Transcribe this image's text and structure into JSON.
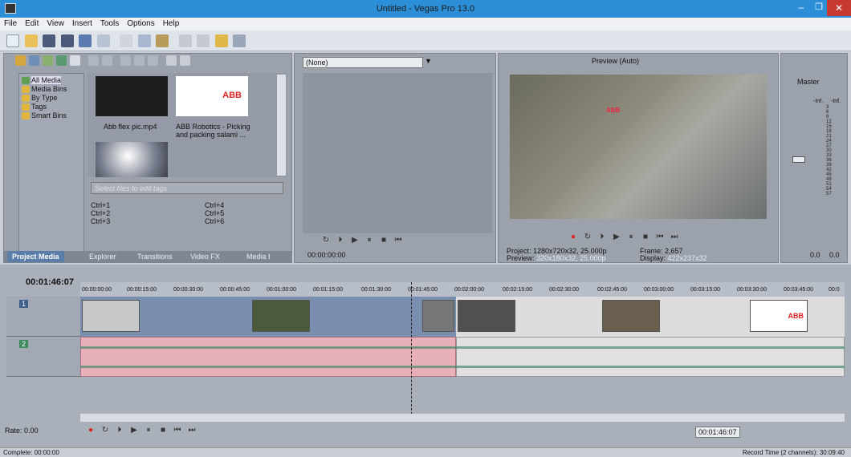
{
  "window": {
    "title": "Untitled - Vegas Pro 13.0"
  },
  "menu": [
    "File",
    "Edit",
    "View",
    "Insert",
    "Tools",
    "Options",
    "Help"
  ],
  "explorer": {
    "tree": [
      "All Media",
      "Media Bins",
      "By Type",
      "Tags",
      "Smart Bins"
    ],
    "media": [
      {
        "name": "Abb flex pic.mp4"
      },
      {
        "name": "ABB Robotics - Picking and packing salami ..."
      }
    ],
    "tags_placeholder": "Select files to edit tags",
    "shortcuts": [
      "Ctrl+1",
      "Ctrl+2",
      "Ctrl+3",
      "Ctrl+4",
      "Ctrl+5",
      "Ctrl+6"
    ],
    "tabs": [
      "Project Media",
      "Explorer",
      "Transitions",
      "Video FX",
      "Media I"
    ]
  },
  "trimmer": {
    "source": "(None)",
    "timecode": "00:00:00:00"
  },
  "preview": {
    "mode": "Preview (Auto)",
    "project_label": "Project:",
    "project": "1280x720x32, 25.000p",
    "preview_label": "Preview:",
    "preview": "320x180x32, 25.000p",
    "frame_label": "Frame:",
    "frame": "2,657",
    "display_label": "Display:",
    "display": "422x237x32"
  },
  "mixer": {
    "title": "Master",
    "left": "-Inf.",
    "right": "-Inf.",
    "scale": [
      "3",
      "6",
      "9",
      "12",
      "15",
      "18",
      "21",
      "24",
      "27",
      "30",
      "33",
      "36",
      "39",
      "42",
      "45",
      "48",
      "51",
      "54",
      "57"
    ],
    "value_l": "0.0",
    "value_r": "0.0"
  },
  "timeline": {
    "time": "00:01:46:07",
    "ruler": [
      "00:00:00:00",
      "00:00:15:00",
      "00:00:30:00",
      "00:00:45:00",
      "00:01:00:00",
      "00:01:15:00",
      "00:01:30:00",
      "00:01:45:00",
      "00:02:00:00",
      "00:02:15:00",
      "00:02:30:00",
      "00:02:45:00",
      "00:03:00:00",
      "00:03:15:00",
      "00:03:30:00",
      "00:03:45:00",
      "00:0"
    ],
    "track1": "1",
    "track2": "2",
    "rate": "Rate: 0.00",
    "timecode": "00:01:46:07"
  },
  "statusbar": {
    "left": "Complete: 00:00:00",
    "right": "Record Time (2 channels): 30:09:40"
  },
  "colors": {
    "titlebar": "#2b8ed6",
    "video_clip": "#7a8fb0",
    "audio_clip_a": "#e8b0b8",
    "audio_clip_b": "#e0e0e0"
  }
}
